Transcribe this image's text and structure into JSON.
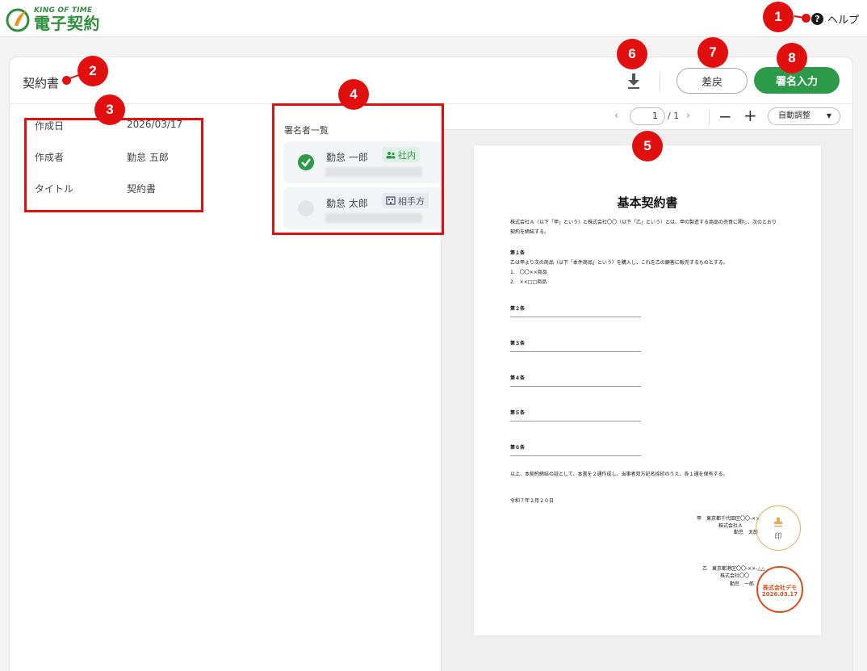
{
  "header": {
    "logo_brand": "KING OF TIME",
    "logo_name": "電子契約",
    "help_icon": "?",
    "help_label": "ヘルプ"
  },
  "toolbar": {
    "page_title": "契約書",
    "download_icon": "download-icon",
    "return_label": "差戻",
    "sign_label": "署名入力"
  },
  "info": {
    "rows": [
      {
        "label": "作成日",
        "value": "2026/03/17"
      },
      {
        "label": "作成者",
        "value": "勤怠 五郎"
      },
      {
        "label": "タイトル",
        "value": "契約書"
      }
    ]
  },
  "signers": {
    "title": "署名者一覧",
    "items": [
      {
        "name": "勤怠 一郎",
        "tag": "社内",
        "status": "signed"
      },
      {
        "name": "勤怠 太郎",
        "tag": "相手方",
        "status": "pending"
      }
    ]
  },
  "viewer": {
    "page_current": "1",
    "page_total": "/ 1",
    "prev_icon": "‹",
    "next_icon": "›",
    "zoom_out": "−",
    "zoom_in": "+",
    "zoom_mode": "自動調整"
  },
  "document": {
    "title": "基本契約書",
    "intro1": "株式会社Ａ（以下「甲」という）と株式会社〇〇（以下「乙」という）とは、甲の製造する商品の売買に関し、次のとおり",
    "intro2": "契約を締結する。",
    "art1": "第１条",
    "art1_body": "乙は甲より次の商品（以下「本件商品」という）を購入し、これを乙の顧客に販売するものとする。",
    "art1_item1": "1.　〇〇××商品",
    "art1_item2": "2.　××□□商品",
    "art2": "第２条",
    "art3": "第３条",
    "art4": "第４条",
    "art5": "第５条",
    "art6": "第６条",
    "dash": "―――――――――――――――――――――――――――",
    "closing": "以上、本契約締結の証として、本書を２通作成し、当事者双方記名捺印のうえ、各１通を保有する。",
    "date": "令和７年２月２０日",
    "party_a1": "甲　東京都千代田区〇〇-××",
    "party_a2": "株式会社Ａ",
    "party_a3": "勤怠　太郎",
    "seal1_text": "印",
    "party_b1": "乙　東京都港区〇〇-××-△△",
    "party_b2": "株式会社〇〇",
    "party_b3": "勤怠　一郎",
    "seal2_line1": "株式会社デモ",
    "seal2_line2": "2026.03.17"
  },
  "markers": [
    "1",
    "2",
    "3",
    "4",
    "5",
    "6",
    "7",
    "8"
  ],
  "colors": {
    "brand_green": "#2d9a4a",
    "marker_red": "#e20f0f",
    "seal_orange": "#d94d1a"
  }
}
